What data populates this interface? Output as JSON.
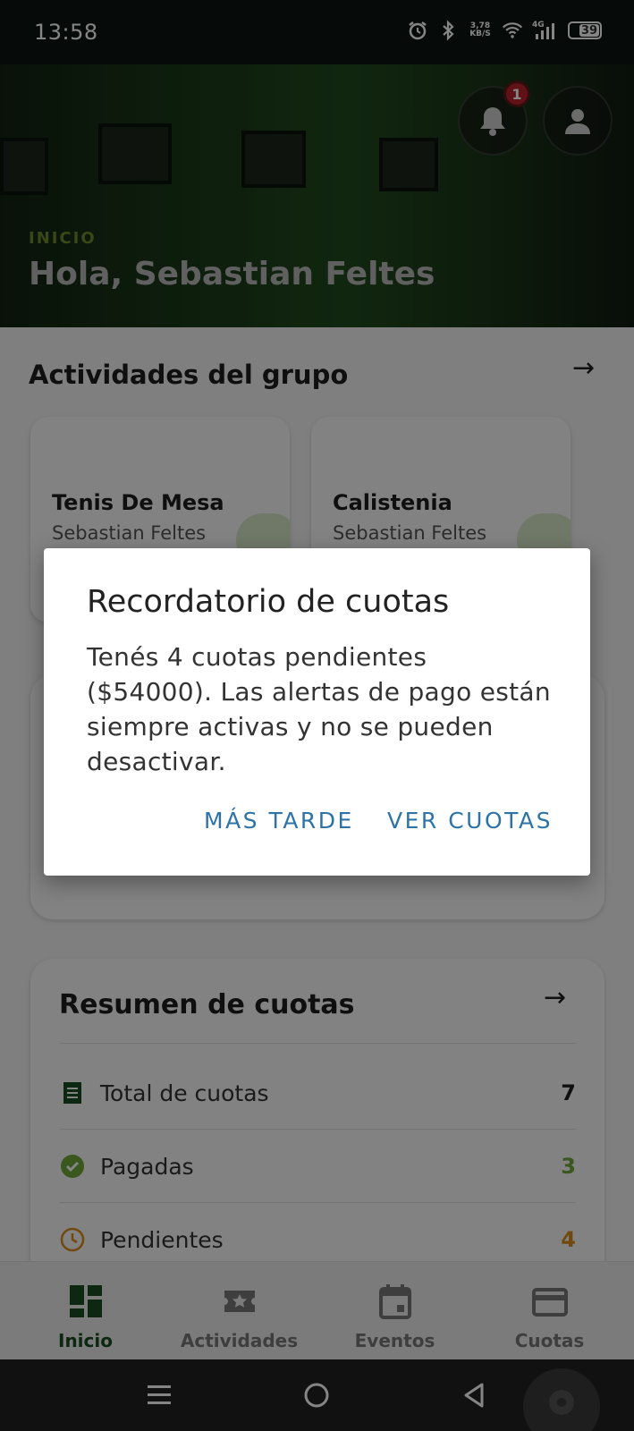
{
  "status_bar": {
    "time": "13:58",
    "net_speed_top": "3,78",
    "net_speed_bottom": "KB/S",
    "network": "4G",
    "battery": "39",
    "icons": [
      "alarm-icon",
      "bluetooth-icon",
      "wifi-icon",
      "signal-icon",
      "battery-icon"
    ]
  },
  "header": {
    "crumb": "INICIO",
    "greeting": "Hola, Sebastian Feltes",
    "notification_count": "1"
  },
  "activities": {
    "title": "Actividades del grupo",
    "cards": [
      {
        "name": "Tenis De Mesa",
        "owner": "Sebastian Feltes"
      },
      {
        "name": "Calistenia",
        "owner": "Sebastian Feltes"
      }
    ]
  },
  "fees": {
    "title": "Resumen de cuotas",
    "rows": [
      {
        "label": "Total de cuotas",
        "value": "7",
        "color": "#1e1e1e",
        "icon": "receipt-icon"
      },
      {
        "label": "Pagadas",
        "value": "3",
        "color": "#6fa83a",
        "icon": "check-circle-icon"
      },
      {
        "label": "Pendientes",
        "value": "4",
        "color": "#d98a1a",
        "icon": "clock-icon"
      }
    ]
  },
  "bottom_nav": {
    "items": [
      {
        "label": "Inicio",
        "icon": "dashboard-icon",
        "active": true
      },
      {
        "label": "Actividades",
        "icon": "ticket-star-icon",
        "active": false
      },
      {
        "label": "Eventos",
        "icon": "calendar-icon",
        "active": false
      },
      {
        "label": "Cuotas",
        "icon": "credit-card-icon",
        "active": false
      }
    ]
  },
  "dialog": {
    "title": "Recordatorio de cuotas",
    "body": "Tenés 4 cuotas pendientes ($54000). Las alertas de pago están siempre activas y no se pueden desactivar.",
    "later_label": "MÁS TARDE",
    "view_label": "VER CUOTAS"
  },
  "colors": {
    "accent_green": "#1a4d1f",
    "dialog_button": "#2d73a8",
    "badge_red": "#b8232b"
  }
}
